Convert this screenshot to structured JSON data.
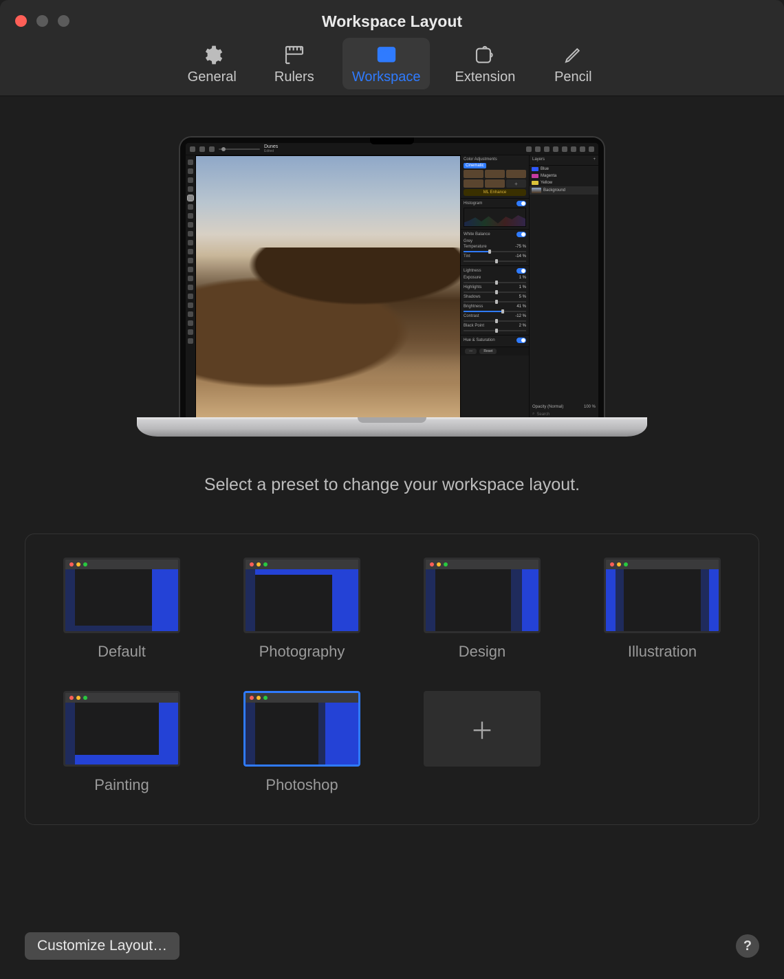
{
  "window": {
    "title": "Workspace Layout"
  },
  "tabs": {
    "general": {
      "label": "General"
    },
    "rulers": {
      "label": "Rulers"
    },
    "workspace": {
      "label": "Workspace"
    },
    "extension": {
      "label": "Extension"
    },
    "pencil": {
      "label": "Pencil"
    }
  },
  "instruction": "Select a preset to change your workspace layout.",
  "presets": {
    "default": {
      "label": "Default"
    },
    "photography": {
      "label": "Photography"
    },
    "design": {
      "label": "Design"
    },
    "illustration": {
      "label": "Illustration"
    },
    "painting": {
      "label": "Painting"
    },
    "photoshop": {
      "label": "Photoshop"
    }
  },
  "footer": {
    "customize": "Customize Layout…",
    "help": "?"
  },
  "preview": {
    "file_name": "Dunes",
    "file_status": "Edited",
    "color_adjustments": "Color Adjustments",
    "preset_name": "Cinematic",
    "ml_enhance": "ML Enhance",
    "histogram": "Histogram",
    "white_balance": "White Balance",
    "grey": "Grey",
    "temperature": {
      "label": "Temperature",
      "value": "-75 %"
    },
    "tint": {
      "label": "Tint",
      "value": "-14 %"
    },
    "lightness": "Lightness",
    "exposure": {
      "label": "Exposure",
      "value": "1 %"
    },
    "highlights": {
      "label": "Highlights",
      "value": "1 %"
    },
    "shadows": {
      "label": "Shadows",
      "value": "5 %"
    },
    "brightness": {
      "label": "Brightness",
      "value": "41 %"
    },
    "contrast": {
      "label": "Contrast",
      "value": "-12 %"
    },
    "blackpoint": {
      "label": "Black Point",
      "value": "2 %"
    },
    "hue_sat": "Hue & Saturation",
    "reset": "Reset",
    "layers": "Layers",
    "layer_blue": "Blue",
    "layer_mag": "Magenta",
    "layer_yel": "Yellow",
    "layer_bg": "Background",
    "opacity": {
      "label": "Opacity (Normal)",
      "value": "100 %"
    },
    "search": "Search"
  }
}
